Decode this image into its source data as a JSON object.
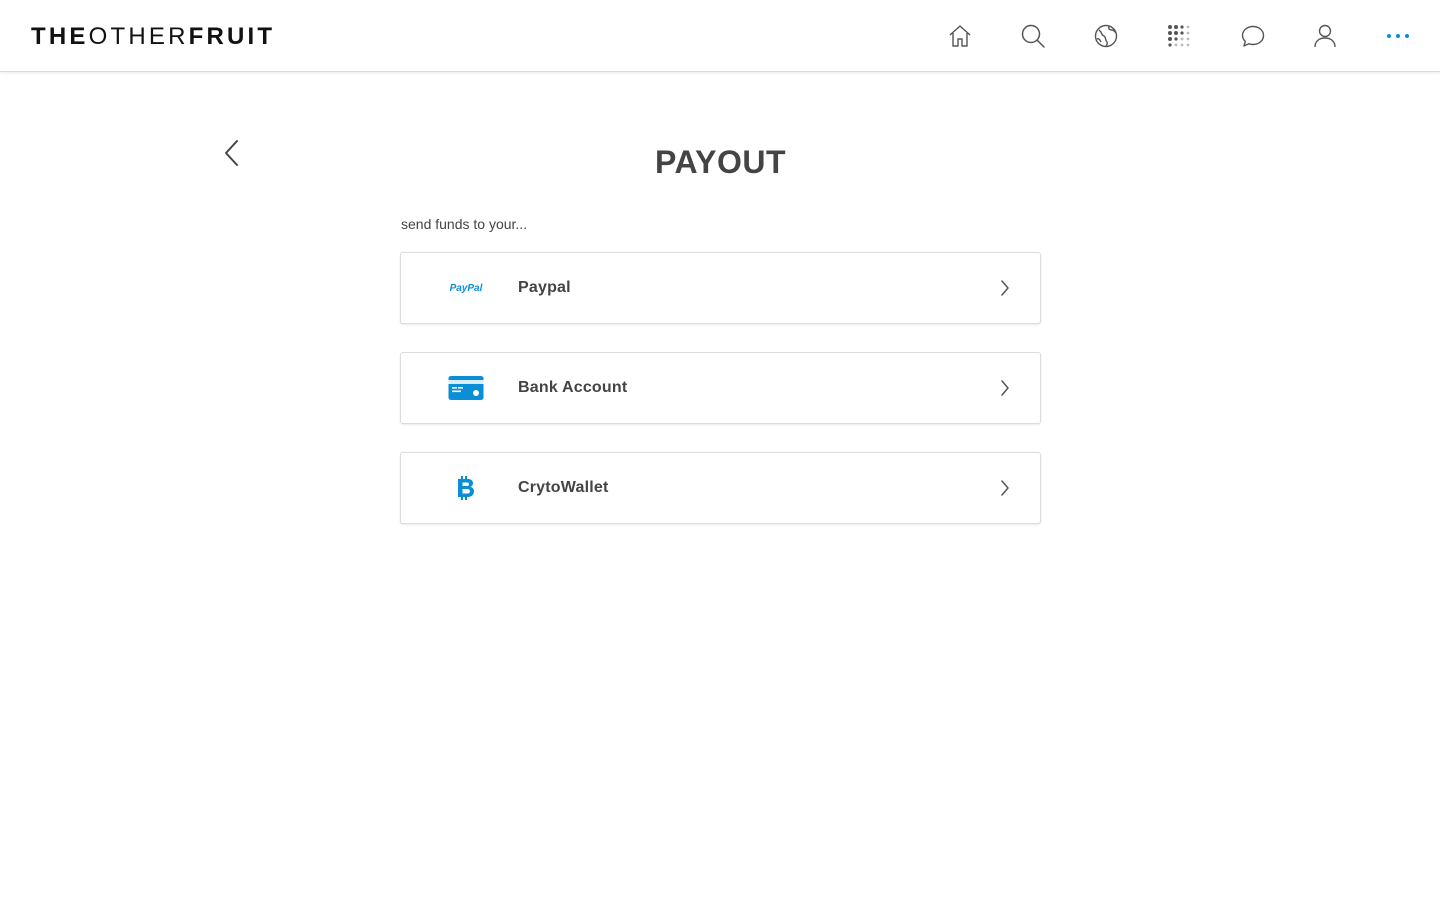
{
  "app": {
    "logo_bold_1": "THE",
    "logo_light": "OTHER",
    "logo_bold_2": "FRUIT"
  },
  "nav": {
    "icons": [
      "home-icon",
      "search-icon",
      "globe-icon",
      "apps-grid-icon",
      "chat-icon",
      "profile-icon",
      "more-icon"
    ]
  },
  "page": {
    "title": "PAYOUT",
    "subtitle": "send funds to your..."
  },
  "options": [
    {
      "label": "Paypal",
      "icon": "paypal-icon",
      "logo_text": "PayPal"
    },
    {
      "label": "Bank Account",
      "icon": "bank-card-icon"
    },
    {
      "label": "CrytoWallet",
      "icon": "bitcoin-icon"
    }
  ],
  "colors": {
    "accent": "#0a8fd6",
    "icon_gray": "#555555",
    "text": "#444444",
    "border": "#dcdcdc"
  }
}
